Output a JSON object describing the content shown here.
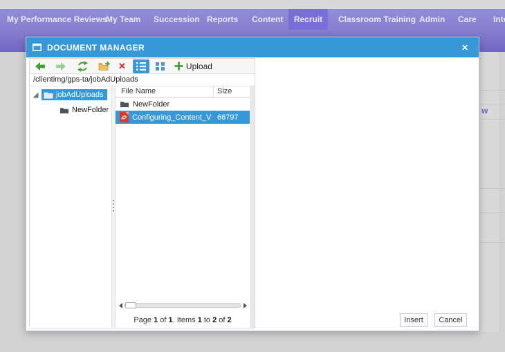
{
  "nav": {
    "items": [
      {
        "label": "My Performance Reviews"
      },
      {
        "label": "My Team"
      },
      {
        "label": "Succession"
      },
      {
        "label": "Reports"
      },
      {
        "label": "Content"
      },
      {
        "label": "Recruit",
        "active": true
      },
      {
        "label": "Classroom Training"
      },
      {
        "label": "Admin"
      },
      {
        "label": "Care"
      },
      {
        "label": "Inte"
      }
    ]
  },
  "background": {
    "partial_link": "w"
  },
  "dialog": {
    "title": "DOCUMENT MANAGER",
    "toolbar": {
      "upload_label": "Upload"
    },
    "address": "/clientimg/gps-ta/jobAdUploads",
    "tree": {
      "root_label": "jobAdUploads",
      "child_label": "NewFolder"
    },
    "list": {
      "col_file_name": "File Name",
      "col_size": "Size",
      "rows": [
        {
          "name": "NewFolder",
          "size": "",
          "type": "folder"
        },
        {
          "name": "Configuring_Content_Vendo",
          "size": "66797",
          "type": "pdf",
          "selected": true
        }
      ]
    },
    "pager": {
      "t1": "Page ",
      "n1": "1",
      "t2": " of ",
      "n2": "1",
      "t3": ". Items ",
      "n3": "1",
      "t4": " to ",
      "n4": "2",
      "t5": " of ",
      "n5": "2"
    },
    "insert_label": "Insert",
    "cancel_label": "Cancel"
  },
  "colors": {
    "accent_blue": "#3798d8",
    "nav_purple": "#867ecf",
    "nav_active_purple": "#7a6ed8",
    "green": "#3f9e37",
    "disabled_green": "#9ccd93",
    "red": "#ce2929",
    "folder_dark": "#49545c",
    "folder_yellow": "#ecc05f"
  }
}
